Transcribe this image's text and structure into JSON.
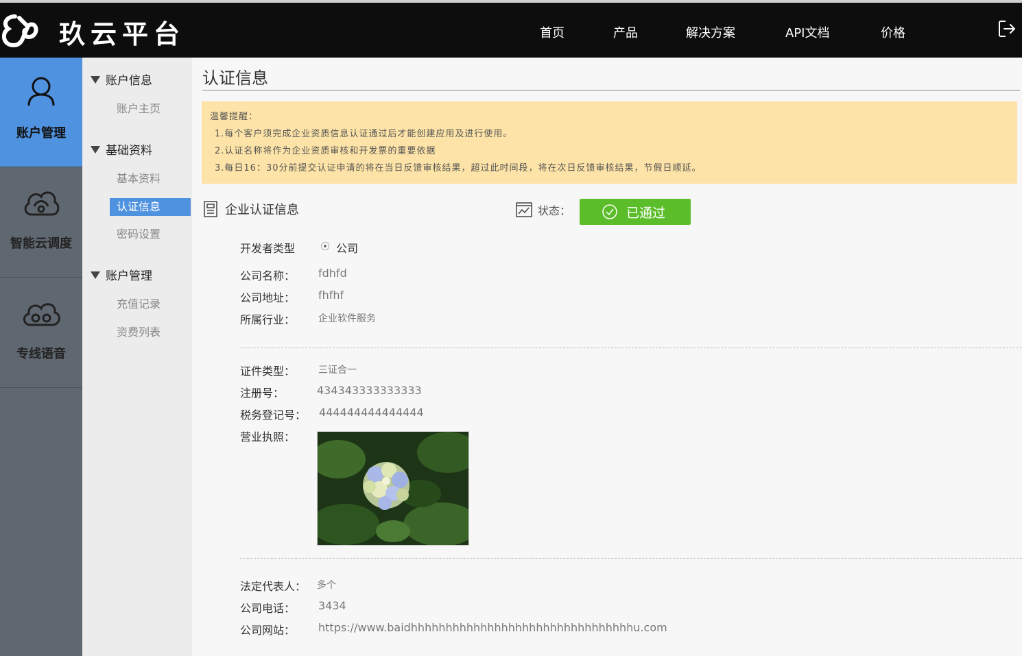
{
  "header": {
    "logo_text": "玖云平台",
    "nav": [
      "首页",
      "产品",
      "解决方案",
      "API文档",
      "价格"
    ]
  },
  "sidebar": {
    "items": [
      {
        "label": "账户管理",
        "icon": "user-icon",
        "active": true
      },
      {
        "label": "智能云调度",
        "icon": "cloud-link-icon",
        "active": false
      },
      {
        "label": "专线语音",
        "icon": "cloud-voice-icon",
        "active": false
      }
    ]
  },
  "subnav": {
    "groups": [
      {
        "title": "账户信息",
        "items": [
          "账户主页"
        ]
      },
      {
        "title": "基础资料",
        "items": [
          "基本资料",
          "认证信息",
          "密码设置"
        ]
      },
      {
        "title": "账户管理",
        "items": [
          "充值记录",
          "资费列表"
        ]
      }
    ],
    "active_item": "认证信息"
  },
  "main": {
    "title": "认证信息",
    "notice": {
      "head": "温馨提醒：",
      "lines": [
        "1.每个客户须完成企业资质信息认证通过后才能创建应用及进行使用。",
        "2.认证名称将作为企业资质审核和开发票的重要依据",
        "3.每日16：30分前提交认证申请的将在当日反馈审核结果，超过此时间段，将在次日反馈审核结果，节假日顺延。"
      ]
    },
    "section_title": "企业认证信息",
    "status_label": "状态：",
    "status_value": "已通过",
    "status_color": "#5cbd2a",
    "developer_type_label": "开发者类型",
    "developer_type_value": "公司",
    "company_name_label": "公司名称：",
    "company_name": "fdhfd",
    "company_address_label": "公司地址：",
    "company_address": "fhfhf",
    "industry_label": "所属行业：",
    "industry": "企业软件服务",
    "cert_type_label": "证件类型：",
    "cert_type": "三证合一",
    "reg_no_label": "注册号：",
    "reg_no": "434343333333333",
    "tax_no_label": "税务登记号：",
    "tax_no": "444444444444444",
    "license_label": "营业执照：",
    "legal_rep_label": "法定代表人：",
    "legal_rep": "多个",
    "phone_label": "公司电话：",
    "phone": "3434",
    "website_label": "公司网站：",
    "website": "https://www.baidhhhhhhhhhhhhhhhhhhhhhhhhhhhhhhhhu.com"
  }
}
